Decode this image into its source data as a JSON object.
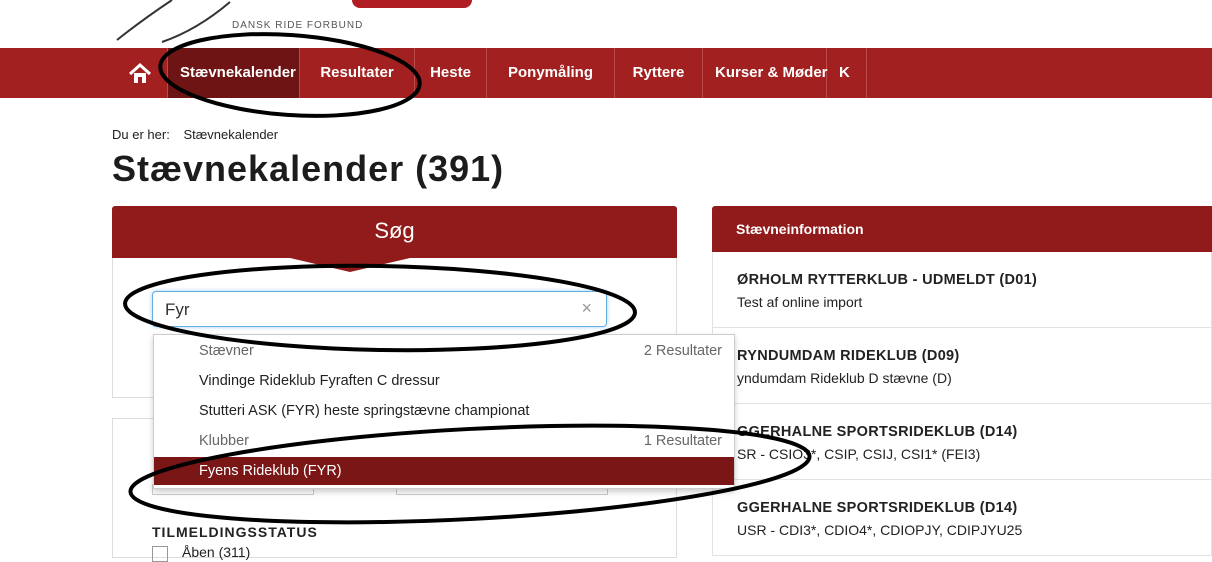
{
  "logo": {
    "text": "DANSK RIDE FORBUND"
  },
  "nav": {
    "items": [
      "Stævnekalender",
      "Resultater",
      "Heste",
      "Ponymåling",
      "Ryttere",
      "Kurser & Møder",
      "K"
    ]
  },
  "breadcrumb": {
    "prefix": "Du er her:",
    "current": "Stævnekalender"
  },
  "page_title": "Stævnekalender (391)",
  "search": {
    "heading": "Søg",
    "value": "Fyr",
    "clear_symbol": "×"
  },
  "dropdown": {
    "groups": [
      {
        "label": "Stævner",
        "count": "2 Resultater",
        "items": [
          "Vindinge Rideklub Fyraften C dressur",
          "Stutteri ASK (FYR) heste springstævne championat"
        ]
      },
      {
        "label": "Klubber",
        "count": "1 Resultater",
        "items": [
          "Fyens Rideklub (FYR)"
        ]
      }
    ]
  },
  "tilmelding": {
    "title": "TILMELDINGSSTATUS",
    "option": "Åben (311)"
  },
  "info": {
    "heading": "Stævneinformation",
    "rows": [
      {
        "club": "ØRHOLM RYTTERKLUB - UDMELDT (D01)",
        "desc": "Test af online import"
      },
      {
        "club": "RYNDUMDAM RIDEKLUB (D09)",
        "desc": "yndumdam Rideklub D stævne (D)"
      },
      {
        "club": "GGERHALNE SPORTSRIDEKLUB (D14)",
        "desc": "SR - CSIO3*, CSIP, CSIJ, CSI1* (FEI3)"
      },
      {
        "club": "GGERHALNE SPORTSRIDEKLUB (D14)",
        "desc": "USR - CDI3*, CDIO4*, CDIOPJY, CDIPJYU25"
      }
    ]
  },
  "colors": {
    "brand_red": "#a32020",
    "dark_red": "#6e1414",
    "highlight": "#7a1616",
    "focus_blue": "#66aee0"
  }
}
